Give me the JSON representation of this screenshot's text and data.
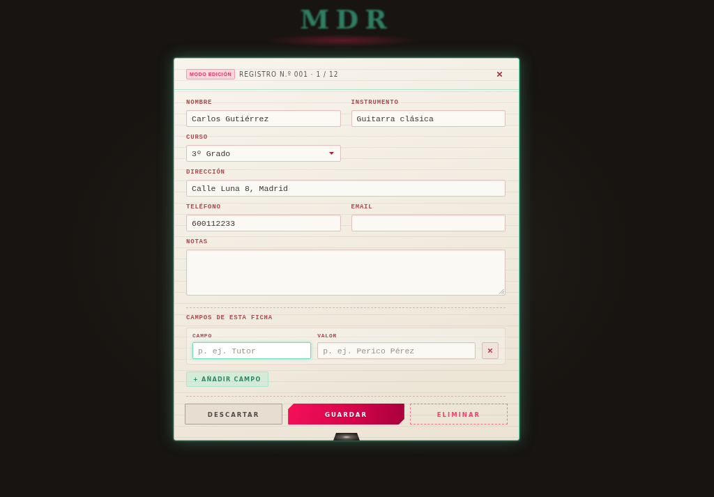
{
  "backdrop": {
    "title": "MDR"
  },
  "dialog": {
    "mode_badge": "MODO EDICIÓN",
    "record": "REGISTRO N.º 001 · 1 / 12",
    "fields": [
      {
        "kind": "text",
        "label": "NOMBRE",
        "value": "Carlos Gutiérrez"
      },
      {
        "kind": "text",
        "label": "INSTRUMENTO",
        "value": "Guitarra clásica"
      },
      {
        "kind": "select",
        "label": "CURSO",
        "value": "3º Grado"
      },
      {
        "kind": "text",
        "label": "DIRECCIÓN",
        "value": "Calle Luna 8, Madrid"
      },
      {
        "kind": "text",
        "label": "TELÉFONO",
        "value": "600112233"
      },
      {
        "kind": "text",
        "label": "EMAIL"
      },
      {
        "kind": "textarea",
        "label": "NOTAS"
      }
    ],
    "custom_fields": {
      "title": "CAMPOS DE ESTA FICHA",
      "rows": [
        {
          "field": {
            "label": "CAMPO",
            "placeholder": "p. ej. Tutor",
            "focused": true
          },
          "value": {
            "label": "VALOR",
            "placeholder": "p. ej. Perico Pérez",
            "focused": false
          }
        }
      ],
      "add_button": "+ AÑADIR CAMPO"
    },
    "actions": [
      {
        "kind": "secondary",
        "label": "DESCARTAR"
      },
      {
        "kind": "primary",
        "label": "GUARDAR"
      },
      {
        "kind": "danger",
        "label": "ELIMINAR"
      }
    ]
  }
}
